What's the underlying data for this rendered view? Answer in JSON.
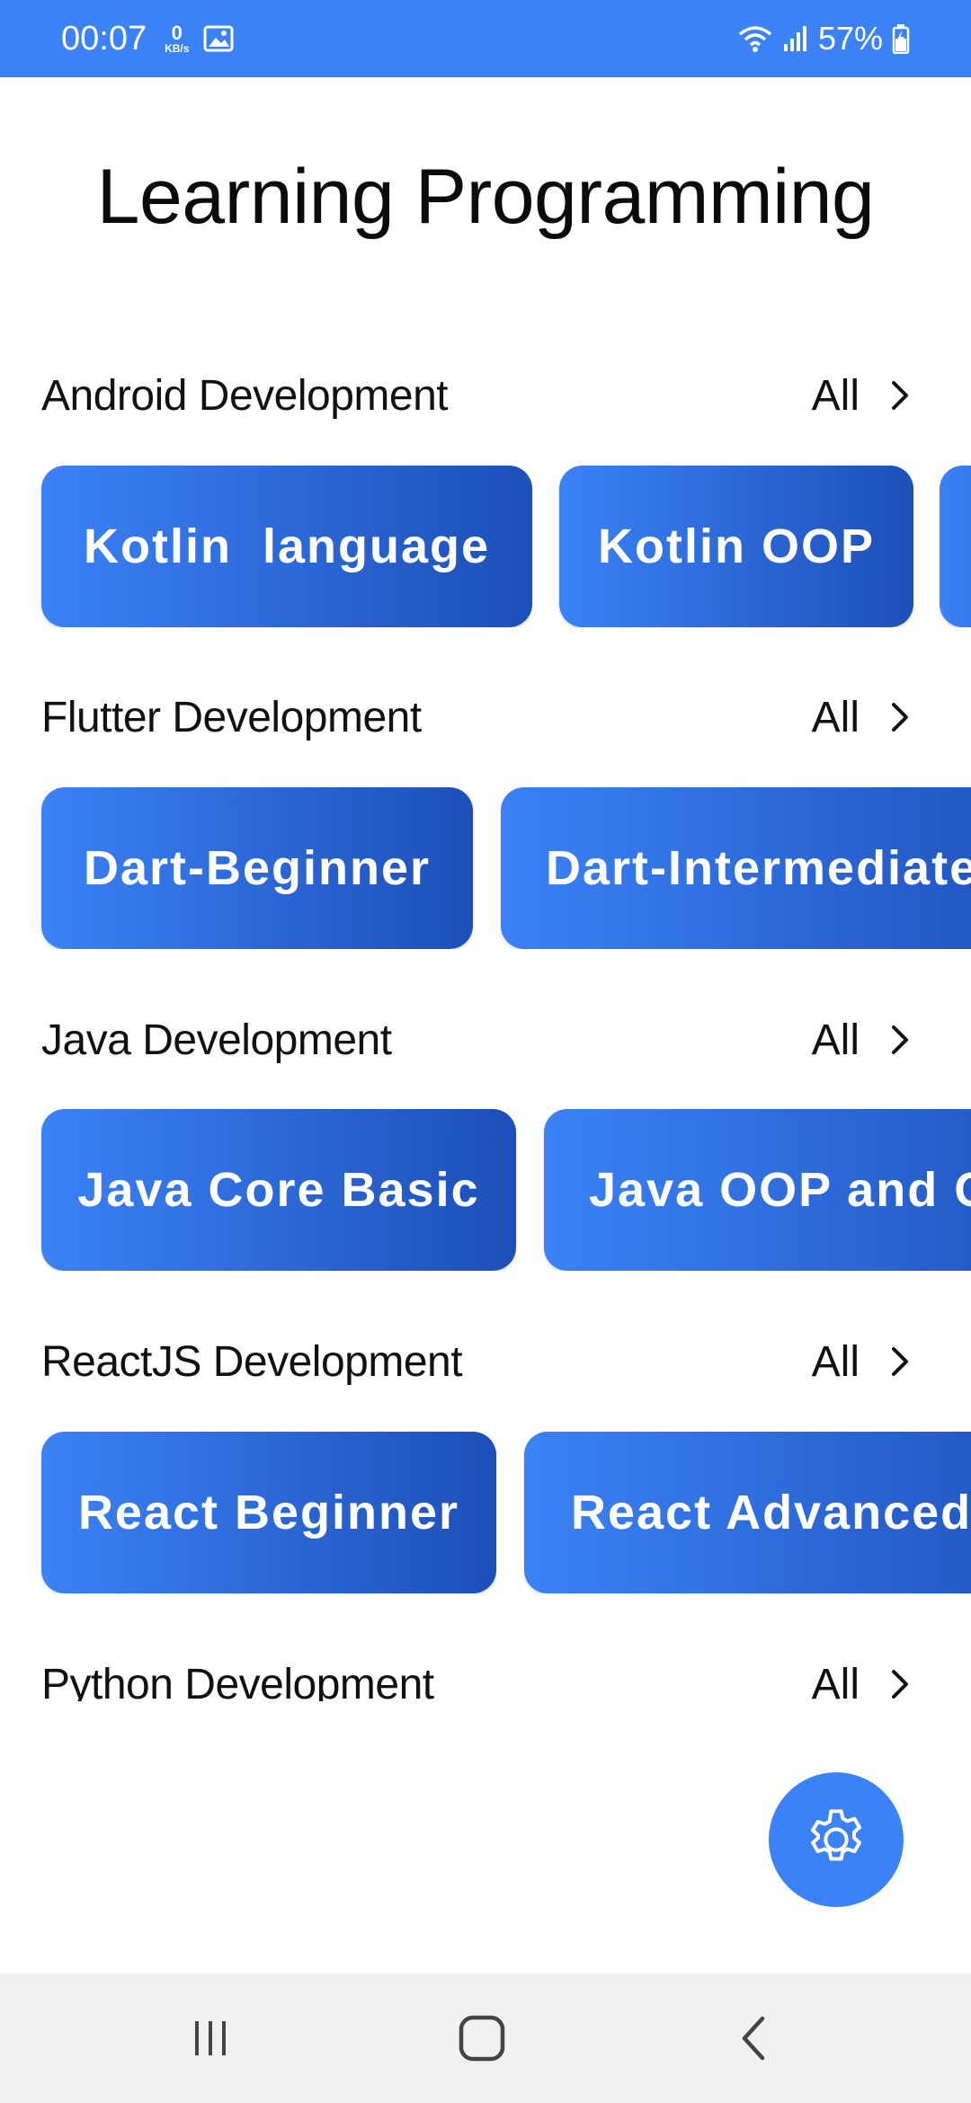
{
  "status_bar": {
    "time": "00:07",
    "net_speed_value": "0",
    "net_speed_unit": "KB/s",
    "battery": "57%",
    "icons": [
      "image-icon",
      "wifi-icon",
      "signal-icon",
      "battery-icon"
    ],
    "background": "#3b82f6"
  },
  "page": {
    "title": "Learning Programming"
  },
  "sections": [
    {
      "title": "Android Development",
      "see_all": "All",
      "chips": [
        "Kotlin  language",
        "Kotlin OOP",
        ""
      ]
    },
    {
      "title": "Flutter Development",
      "see_all": "All",
      "chips": [
        "Dart-Beginner",
        "Dart-Intermediate"
      ]
    },
    {
      "title": "Java Development",
      "see_all": "All",
      "chips": [
        "Java Core Basic",
        "Java OOP and C"
      ]
    },
    {
      "title": "ReactJS Development",
      "see_all": "All",
      "chips": [
        "React Beginner",
        "React Advanced"
      ]
    },
    {
      "title": "Python Development",
      "see_all": "All",
      "chips": []
    }
  ],
  "fab": {
    "icon": "gear-icon",
    "color": "#3b82f6"
  },
  "nav_bar": {
    "icons": [
      "recent-apps-icon",
      "home-icon",
      "back-icon"
    ]
  },
  "colors": {
    "chip_start": "#3b82f6",
    "chip_end": "#1d4fb8"
  }
}
